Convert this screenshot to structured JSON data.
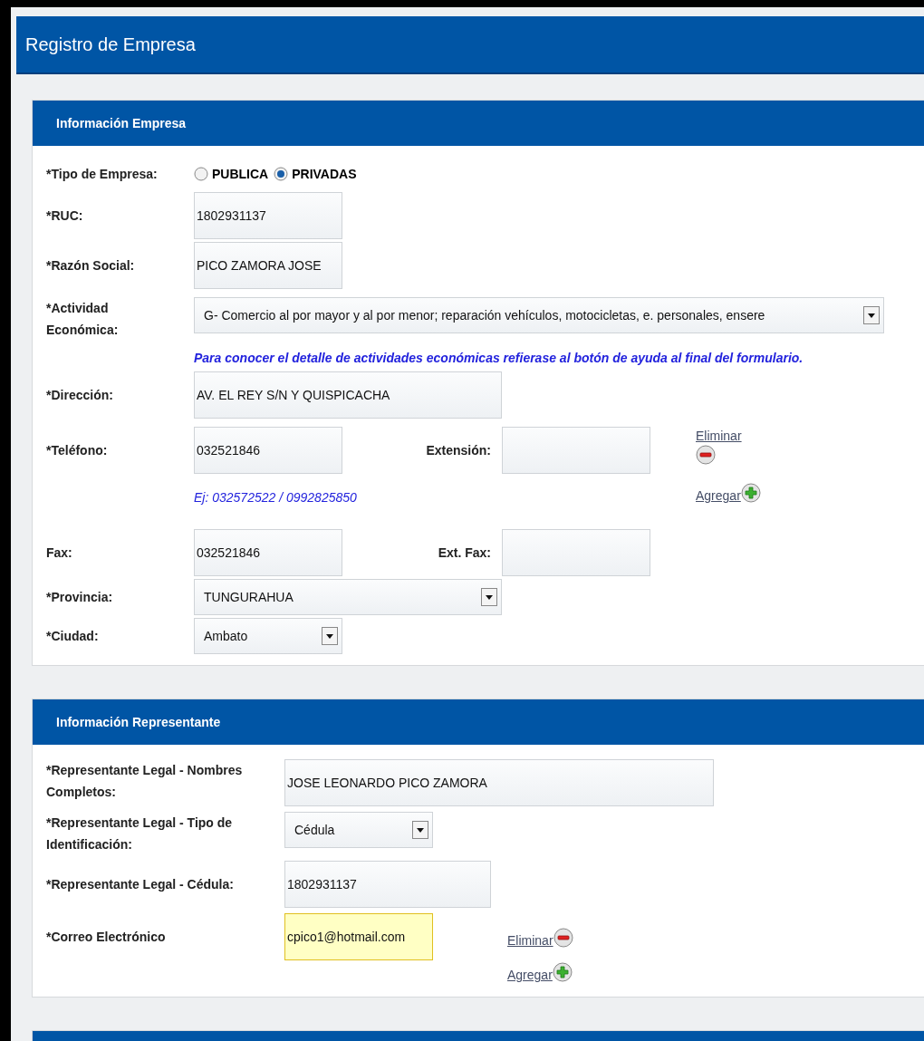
{
  "title": "Registro de Empresa",
  "sections": [
    {
      "kind": "company",
      "title": "Información Empresa",
      "rows": [
        {
          "kind": "radio",
          "label": "*Tipo de Empresa:",
          "options": [
            {
              "label": "PUBLICA",
              "selected": false
            },
            {
              "label": "PRIVADAS",
              "selected": true
            }
          ]
        },
        {
          "kind": "text",
          "label": "*RUC:",
          "value": "1802931137"
        },
        {
          "kind": "text",
          "label": "*Razón Social:",
          "value": "PICO ZAMORA JOSE"
        },
        {
          "kind": "select",
          "label": "*Actividad Económica:",
          "value": "G- Comercio al por mayor y al por menor; reparación vehículos, motocicletas, e. personales, ensere"
        },
        {
          "kind": "note",
          "text": "Para conocer el detalle de actividades económicas refierase al botón de ayuda al final del formulario."
        },
        {
          "kind": "text",
          "label": "*Dirección:",
          "value": "AV. EL REY S/N Y QUISPICACHA"
        },
        {
          "kind": "phone",
          "label": "*Teléfono:",
          "value": "032521846",
          "ext_label": "Extensión:",
          "hint": "Ej: 032572522 / 0992825850",
          "actions": [
            {
              "kind": "remove",
              "label": "Eliminar"
            },
            {
              "kind": "add",
              "label": "Agregar"
            }
          ]
        },
        {
          "kind": "pair",
          "label": "Fax:",
          "value": "032521846",
          "ext_label": "Ext. Fax:"
        },
        {
          "kind": "select",
          "label": "*Provincia:",
          "value": "TUNGURAHUA"
        },
        {
          "kind": "select",
          "label": "*Ciudad:",
          "value": "Ambato"
        }
      ]
    },
    {
      "kind": "representative",
      "title": "Información Representante",
      "rows": [
        {
          "kind": "text",
          "label": "*Representante Legal - Nombres Completos:",
          "value": "JOSE LEONARDO PICO ZAMORA"
        },
        {
          "kind": "select",
          "label": "*Representante Legal - Tipo de Identificación:",
          "value": "Cédula"
        },
        {
          "kind": "text",
          "label": "*Representante Legal - Cédula:",
          "value": "1802931137"
        },
        {
          "kind": "email",
          "label": "*Correo Electrónico",
          "value": "cpico1@hotmail.com",
          "focused": true,
          "actions": [
            {
              "kind": "remove",
              "label": "Eliminar"
            },
            {
              "kind": "add",
              "label": "Agregar"
            }
          ]
        }
      ]
    },
    {
      "kind": "cut_off"
    }
  ]
}
